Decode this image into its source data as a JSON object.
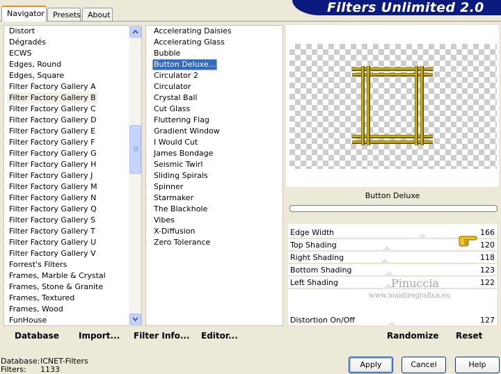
{
  "tabs": [
    "Navigator",
    "Presets",
    "About"
  ],
  "app_title": "Filters Unlimited 2.0",
  "categories": [
    "Distort",
    "Dégradés",
    "ECWS",
    "Edges, Round",
    "Edges, Square",
    "Filter Factory Gallery A",
    "Filter Factory Gallery B",
    "Filter Factory Gallery C",
    "Filter Factory Gallery D",
    "Filter Factory Gallery E",
    "Filter Factory Gallery F",
    "Filter Factory Gallery G",
    "Filter Factory Gallery H",
    "Filter Factory Gallery J",
    "Filter Factory Gallery M",
    "Filter Factory Gallery N",
    "Filter Factory Gallery Q",
    "Filter Factory Gallery S",
    "Filter Factory Gallery T",
    "Filter Factory Gallery U",
    "Filter Factory Gallery V",
    "Forrest's Filters",
    "Frames, Marble & Crystal",
    "Frames, Stone & Granite",
    "Frames, Textured",
    "Frames, Wood",
    "FunHouse"
  ],
  "selected_category": "Filter Factory Gallery B",
  "filters": [
    "Accelerating Daisies",
    "Accelerating Glass",
    "Bubble",
    "Button Deluxe...",
    "Circulator 2",
    "Circulator",
    "Crystal Ball",
    "Cut Glass",
    "Fluttering Flag",
    "Gradient Window",
    "I Would Cut",
    "James Bondage",
    "Seismic Twirl",
    "Sliding Spirals",
    "Spinner",
    "Starmaker",
    "The Blackhole",
    "Vibes",
    "X-Diffusion",
    "Zero Tolerance"
  ],
  "selected_filter": "Button Deluxe...",
  "filter_name": "Button Deluxe",
  "params": [
    {
      "label": "Edge Width",
      "value": "166"
    },
    {
      "label": "Top Shading",
      "value": "120"
    },
    {
      "label": "Right Shading",
      "value": "118"
    },
    {
      "label": "Bottom Shading",
      "value": "123"
    },
    {
      "label": "Left Shading",
      "value": "122"
    },
    {
      "label": "Distortion On/Off",
      "value": "127"
    }
  ],
  "watermark": {
    "name": "Pinuccia",
    "url": "www.maidiregrafica.eu"
  },
  "bottom_buttons": {
    "database": "Database",
    "import": "Import...",
    "filter_info": "Filter Info...",
    "editor": "Editor...",
    "randomize": "Randomize",
    "reset": "Reset"
  },
  "status": {
    "database_label": "Database:",
    "database_value": "ICNET-Filters",
    "filters_label": "Filters:",
    "filters_value": "1133"
  },
  "dialog_buttons": {
    "apply": "Apply",
    "cancel": "Cancel",
    "help": "Help"
  },
  "colors": {
    "banner": "#0a1a7e",
    "selection": "#316ac5",
    "frame_gold": "#c8a400"
  }
}
